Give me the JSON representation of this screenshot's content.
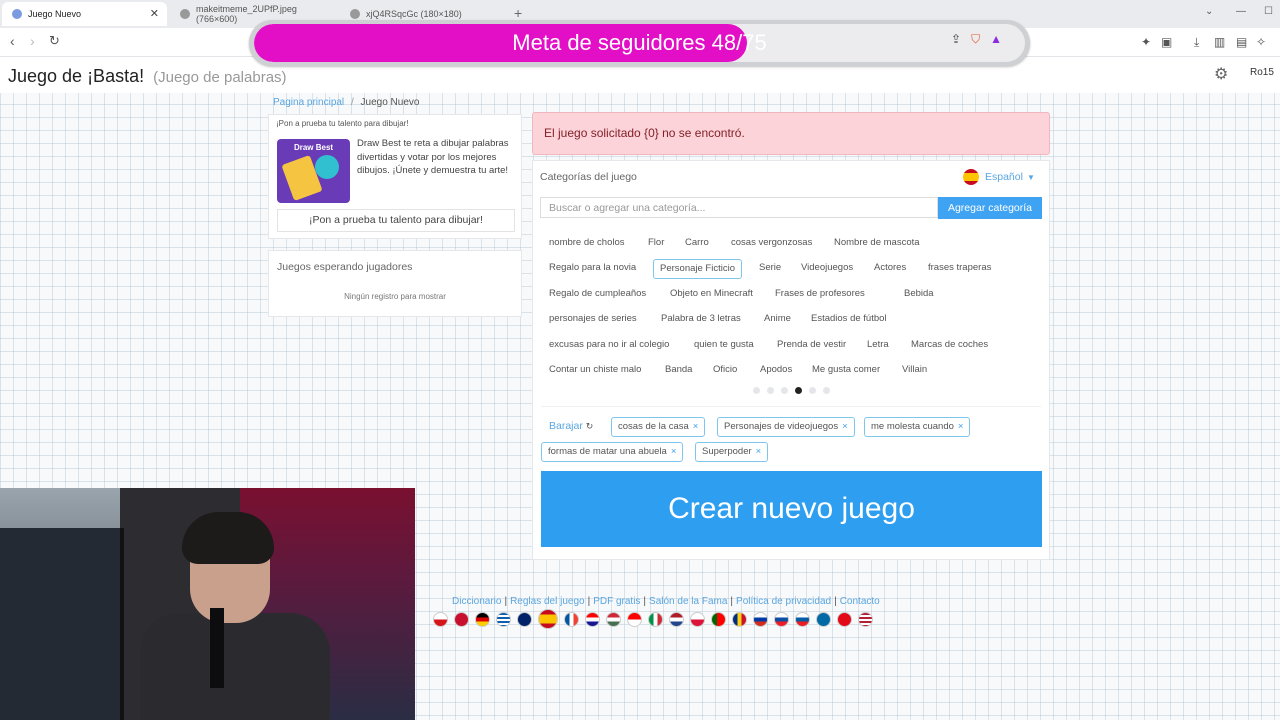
{
  "browser": {
    "tabs": [
      {
        "title": "Juego Nuevo",
        "active": true
      },
      {
        "title": "makeitmeme_2UPfP.jpeg (766×600)",
        "active": false
      },
      {
        "title": "xjQ4RSqcGc (180×180)",
        "active": false
      }
    ],
    "new_tab": "+"
  },
  "goal": {
    "text": "Meta de seguidores 48/75",
    "current": 48,
    "target": 75,
    "fill_color": "#e30fc6"
  },
  "header": {
    "title": "Juego de ¡Basta!",
    "subtitle": "(Juego de palabras)",
    "user": "Ro15"
  },
  "breadcrumb": {
    "home": "Pagina principal",
    "separator": "/",
    "current": "Juego Nuevo"
  },
  "promo": {
    "heading": "¡Pon a prueba tu talento para dibujar!",
    "image_title": "Draw Best",
    "description": "Draw Best te reta a dibujar palabras divertidas y votar por los mejores dibujos. ¡Únete y demuestra tu arte!",
    "button": "¡Pon a prueba tu talento para dibujar!"
  },
  "waiting": {
    "title": "Juegos esperando jugadores",
    "empty": "Ningún registro para mostrar"
  },
  "alert": {
    "message": "El juego solicitado {0} no se encontró."
  },
  "categories": {
    "title": "Categorías del juego",
    "language": "Español",
    "search_placeholder": "Buscar o agregar una categoría...",
    "add_button": "Agregar categoría",
    "rows": [
      [
        "nombre de cholos",
        "Flor",
        "Carro",
        "cosas vergonzosas",
        "Nombre de mascota"
      ],
      [
        "Regalo para la novia",
        "Personaje Ficticio",
        "Serie",
        "Videojuegos",
        "Actores",
        "frases traperas"
      ],
      [
        "Regalo de cumpleaños",
        "Objeto en Minecraft",
        "Frases de profesores",
        "Bebida"
      ],
      [
        "personajes de series",
        "Palabra de 3 letras",
        "Anime",
        "Estadios de fútbol"
      ],
      [
        "excusas para no ir al colegio",
        "quien te gusta",
        "Prenda de vestir",
        "Letra",
        "Marcas de coches"
      ],
      [
        "Contar un chiste malo",
        "Banda",
        "Oficio",
        "Apodos",
        "Me gusta comer",
        "Villain"
      ]
    ],
    "page_count": 6,
    "current_page": 4,
    "shuffle": "Barajar",
    "selected": [
      "cosas de la casa",
      "Personajes de videojuegos",
      "me molesta cuando",
      "formas de matar una abuela",
      "Superpoder"
    ],
    "create_button": "Crear nuevo juego",
    "accent_color": "#2e9ef0"
  },
  "footer": {
    "links": [
      "Diccionario",
      "Reglas del juego",
      "PDF gratis",
      "Salón de la Fama",
      "Política de privacidad",
      "Contacto"
    ],
    "separator": "|"
  }
}
